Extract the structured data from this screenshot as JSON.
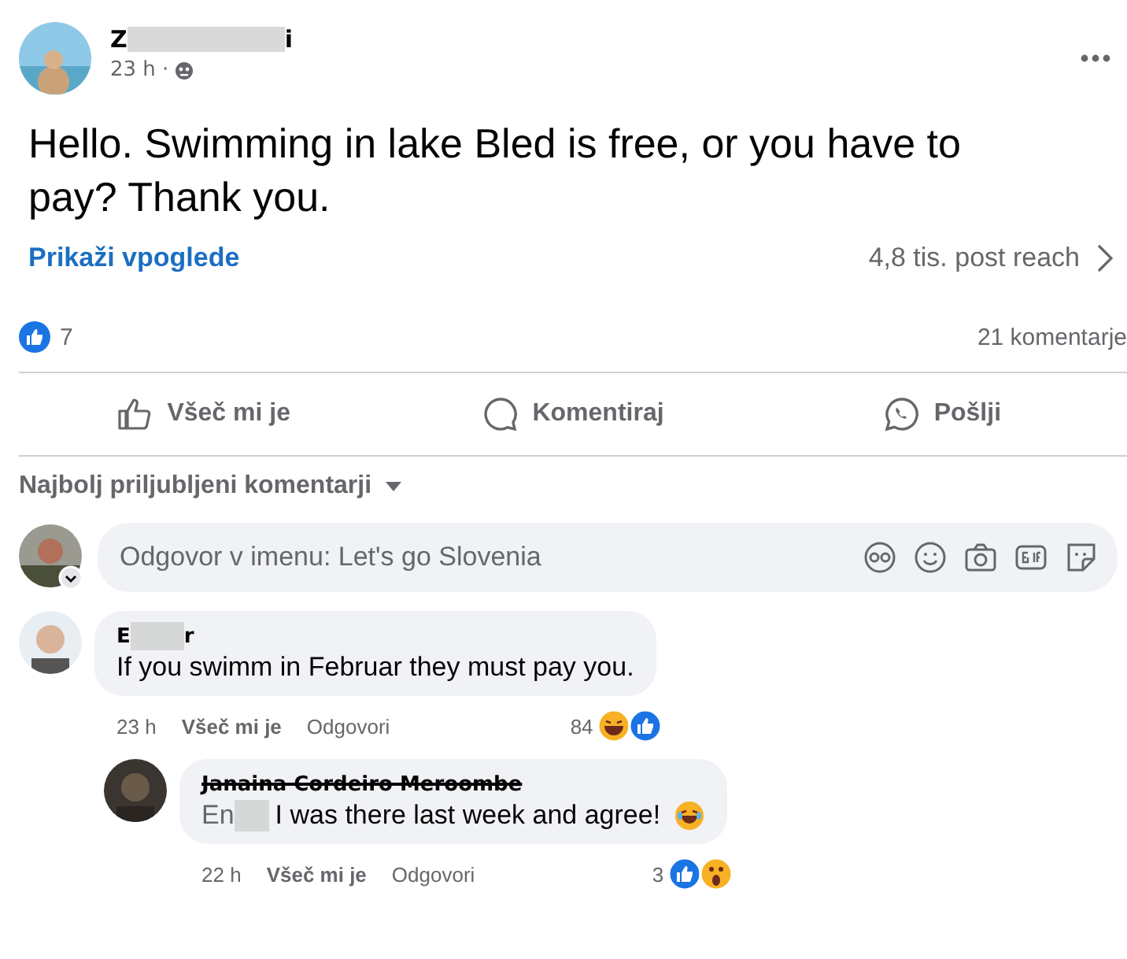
{
  "post": {
    "author_start": "Z",
    "author_end": "i",
    "time": "23 h ·",
    "text": "Hello. Swimming in lake Bled is free, or you have to pay? Thank you.",
    "insights_link": "Prikaži vpoglede",
    "reach": "4,8 tis. post reach"
  },
  "stats": {
    "likes": "7",
    "comments": "21 komentarje"
  },
  "actions": [
    {
      "kind": "like",
      "label": "Všeč mi je"
    },
    {
      "kind": "comment",
      "label": "Komentiraj"
    },
    {
      "kind": "share",
      "label": "Pošlji"
    }
  ],
  "sort": {
    "label": "Najbolj priljubljeni komentarji"
  },
  "composer": {
    "placeholder": "Odgovor v imenu: Let's go Slovenia"
  },
  "comments": [
    {
      "author_start": "E",
      "author_end": "r",
      "text": "If you swimm in Februar they must pay you.",
      "time": "23 h",
      "like": "Všeč mi je",
      "reply": "Odgovori",
      "count": "84",
      "reactions": [
        {
          "kind": "haha"
        },
        {
          "kind": "like"
        }
      ],
      "struck": false,
      "emoji": false
    },
    {
      "author_start": "Janaina Cordeiro Meroombe",
      "text_start": "En",
      "text": "I was there last week and agree!",
      "time": "22 h",
      "like": "Všeč mi je",
      "reply": "Odgovori",
      "count": "3",
      "reactions": [
        {
          "kind": "like"
        },
        {
          "kind": "wow"
        }
      ],
      "struck": true,
      "emoji": true
    }
  ]
}
